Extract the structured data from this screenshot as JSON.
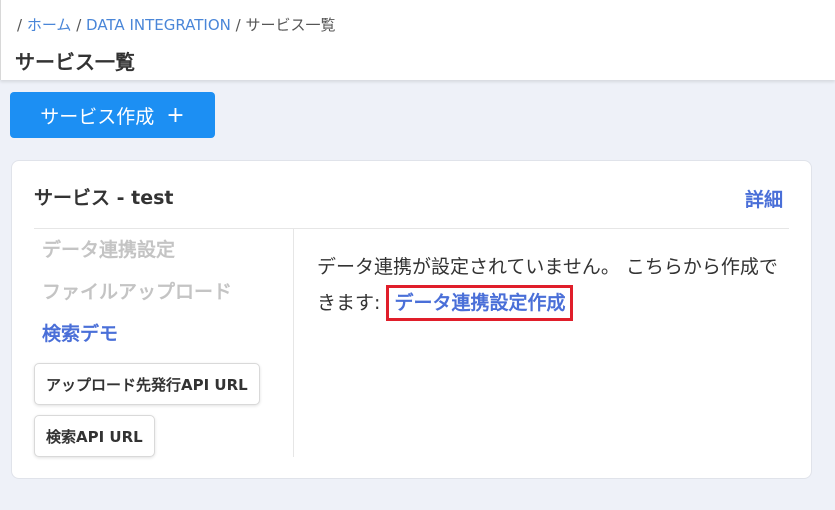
{
  "breadcrumb": {
    "sep": "/",
    "home": "ホーム",
    "integration": "DATA INTEGRATION",
    "current": "サービス一覧"
  },
  "header": {
    "title": "サービス一覧"
  },
  "actions": {
    "create_label": "サービス作成",
    "create_icon": "+"
  },
  "card": {
    "title": "サービス - test",
    "detail_label": "詳細",
    "sidebar": {
      "items": [
        {
          "label": "データ連携設定",
          "state": "disabled"
        },
        {
          "label": "ファイルアップロード",
          "state": "disabled"
        },
        {
          "label": "検索デモ",
          "state": "active"
        }
      ],
      "upload_url_label": "アップロード先発行API URL",
      "search_url_label": "検索API URL"
    },
    "content": {
      "message": "データ連携が設定されていません。 こちらから作成できます: ",
      "link_label": "データ連携設定作成"
    }
  },
  "colors": {
    "accent": "#1c8ff3",
    "link": "#4a6fd8",
    "highlight_border": "#e01e2a",
    "disabled": "#c4c4c4"
  }
}
